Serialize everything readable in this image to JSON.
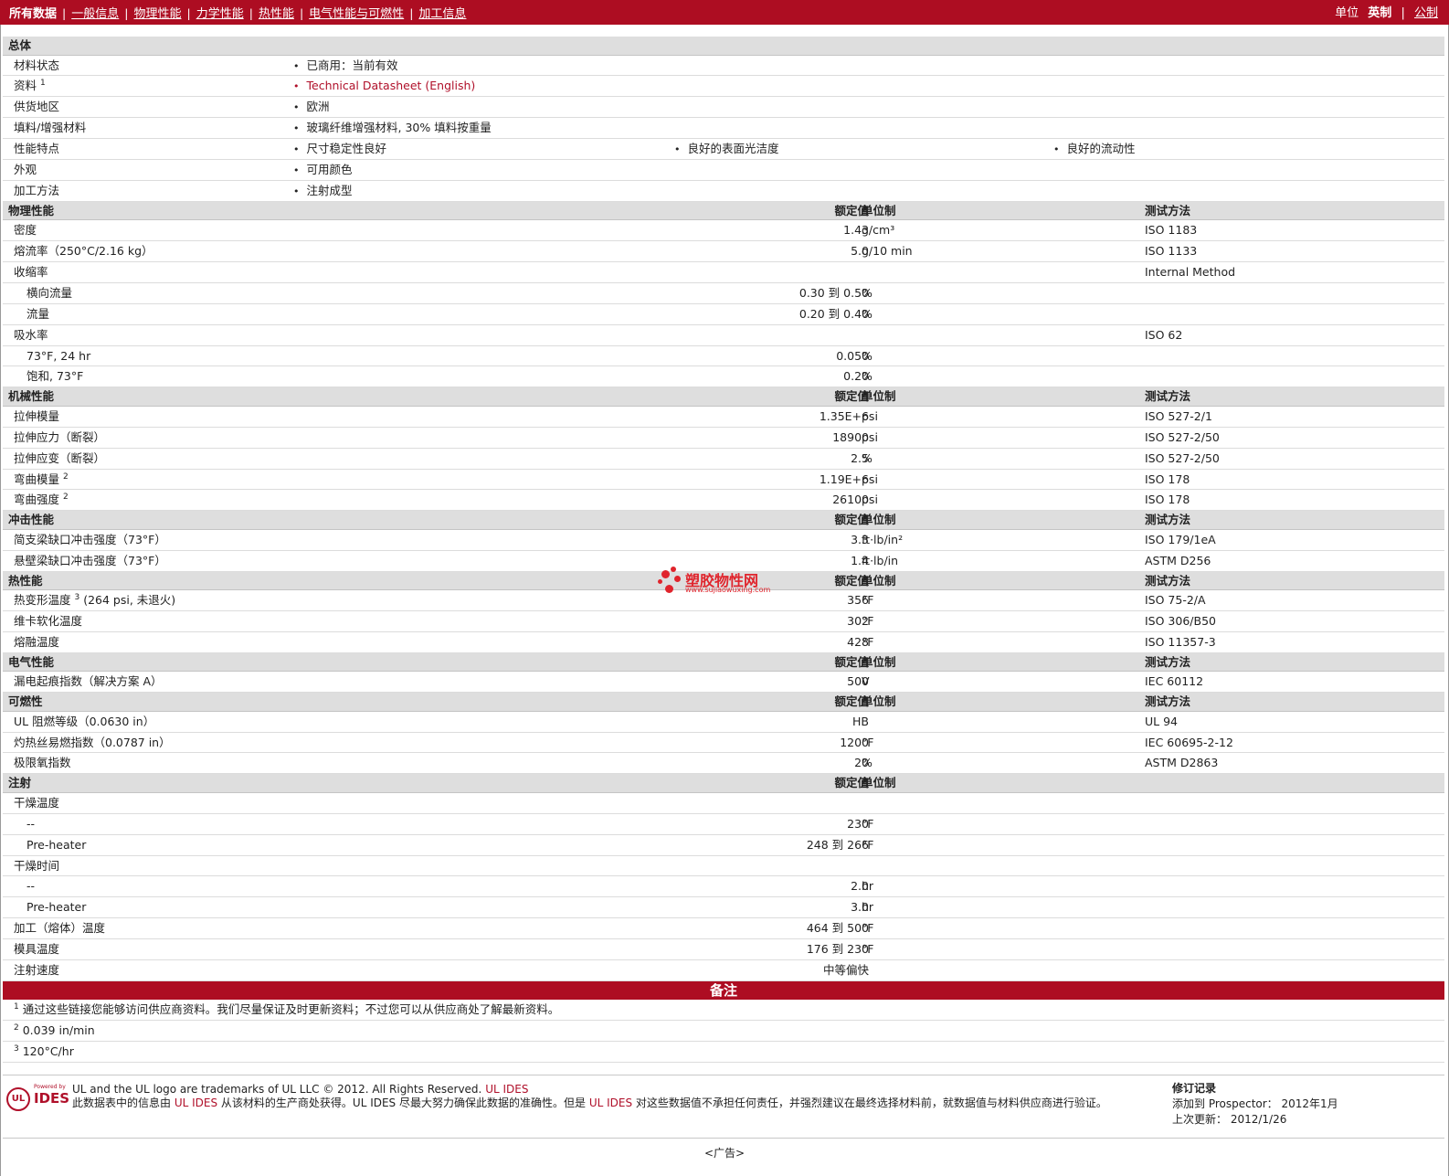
{
  "nav": {
    "tabs": [
      "所有数据",
      "一般信息",
      "物理性能",
      "力学性能",
      "热性能",
      "电气性能与可燃性",
      "加工信息"
    ],
    "units_label": "单位",
    "unit_imperial": "英制",
    "unit_metric": "公制"
  },
  "general": {
    "title": "总体",
    "rows": [
      {
        "label": "材料状态",
        "items": [
          "已商用：当前有效"
        ]
      },
      {
        "label": "资料",
        "sup": "1",
        "items": [
          "Technical Datasheet (English)"
        ],
        "link": true
      },
      {
        "label": "供货地区",
        "items": [
          "欧洲"
        ]
      },
      {
        "label": "填料/增强材料",
        "items": [
          "玻璃纤维增强材料, 30% 填料按重量"
        ]
      },
      {
        "label": "性能特点",
        "items": [
          "尺寸稳定性良好",
          "良好的表面光洁度",
          "良好的流动性"
        ]
      },
      {
        "label": "外观",
        "items": [
          "可用颜色"
        ]
      },
      {
        "label": "加工方法",
        "items": [
          "注射成型"
        ]
      }
    ]
  },
  "col_headers": {
    "value": "额定值",
    "unit": "单位制",
    "method": "测试方法"
  },
  "sections": [
    {
      "title": "物理性能",
      "has_method": true,
      "rows": [
        {
          "label": "密度",
          "value": "1.43",
          "unit": "g/cm³",
          "method": "ISO 1183"
        },
        {
          "label": "熔流率（250°C/2.16 kg）",
          "value": "5.0",
          "unit": "g/10 min",
          "method": "ISO 1133"
        },
        {
          "label": "收缩率",
          "value": "",
          "unit": "",
          "method": "Internal Method"
        },
        {
          "label": "横向流量",
          "sub": true,
          "value": "0.30 到  0.50",
          "unit": "%",
          "method": ""
        },
        {
          "label": "流量",
          "sub": true,
          "value": "0.20 到  0.40",
          "unit": "%",
          "method": ""
        },
        {
          "label": "吸水率",
          "value": "",
          "unit": "",
          "method": "ISO 62"
        },
        {
          "label": "73°F, 24 hr",
          "sub": true,
          "value": "0.050",
          "unit": "%",
          "method": ""
        },
        {
          "label": "饱和, 73°F",
          "sub": true,
          "value": "0.20",
          "unit": "%",
          "method": ""
        }
      ]
    },
    {
      "title": "机械性能",
      "has_method": true,
      "rows": [
        {
          "label": "拉伸模量",
          "value": "1.35E+6",
          "unit": "psi",
          "method": "ISO 527-2/1"
        },
        {
          "label": "拉伸应力（断裂）",
          "value": "18900",
          "unit": "psi",
          "method": "ISO 527-2/50"
        },
        {
          "label": "拉伸应变（断裂）",
          "value": "2.5",
          "unit": "%",
          "method": "ISO 527-2/50"
        },
        {
          "label": "弯曲模量",
          "sup": "2",
          "value": "1.19E+6",
          "unit": "psi",
          "method": "ISO 178"
        },
        {
          "label": "弯曲强度",
          "sup": "2",
          "value": "26100",
          "unit": "psi",
          "method": "ISO 178"
        }
      ]
    },
    {
      "title": "冲击性能",
      "has_method": true,
      "rows": [
        {
          "label": "简支梁缺口冲击强度（73°F）",
          "value": "3.3",
          "unit": "ft·lb/in²",
          "method": "ISO 179/1eA"
        },
        {
          "label": "悬壁梁缺口冲击强度（73°F）",
          "value": "1.4",
          "unit": "ft·lb/in",
          "method": "ASTM D256"
        }
      ]
    },
    {
      "title": "热性能",
      "has_method": true,
      "rows": [
        {
          "label": "热变形温度",
          "sup": "3",
          "label_after": " (264 psi, 未退火)",
          "value": "356",
          "unit": "°F",
          "method": "ISO 75-2/A"
        },
        {
          "label": "维卡软化温度",
          "value": "302",
          "unit": "°F",
          "method": "ISO 306/B50"
        },
        {
          "label": "熔融温度",
          "value": "428",
          "unit": "°F",
          "method": "ISO 11357-3"
        }
      ]
    },
    {
      "title": "电气性能",
      "has_method": true,
      "rows": [
        {
          "label": "漏电起痕指数（解决方案  A）",
          "value": "500",
          "unit": "V",
          "method": "IEC 60112"
        }
      ]
    },
    {
      "title": "可燃性",
      "has_method": true,
      "rows": [
        {
          "label": "UL 阻燃等级（0.0630 in）",
          "value": "HB",
          "unit": "",
          "method": "UL 94"
        },
        {
          "label": "灼热丝易燃指数（0.0787 in）",
          "value": "1200",
          "unit": "°F",
          "method": "IEC 60695-2-12"
        },
        {
          "label": "极限氧指数",
          "value": "20",
          "unit": "%",
          "method": "ASTM D2863"
        }
      ]
    },
    {
      "title": "注射",
      "has_method": false,
      "rows": [
        {
          "label": "干燥温度",
          "value": "",
          "unit": "",
          "method": ""
        },
        {
          "label": "--",
          "sub": true,
          "value": "230",
          "unit": "°F",
          "method": ""
        },
        {
          "label": "Pre-heater",
          "sub": true,
          "value": "248 到  266",
          "unit": "°F",
          "method": ""
        },
        {
          "label": "干燥时间",
          "value": "",
          "unit": "",
          "method": ""
        },
        {
          "label": "--",
          "sub": true,
          "value": "2.0",
          "unit": "hr",
          "method": ""
        },
        {
          "label": "Pre-heater",
          "sub": true,
          "value": "3.0",
          "unit": "hr",
          "method": ""
        },
        {
          "label": "加工（熔体）温度",
          "value": "464 到  500",
          "unit": "°F",
          "method": ""
        },
        {
          "label": "模具温度",
          "value": "176 到  230",
          "unit": "°F",
          "method": ""
        },
        {
          "label": "注射速度",
          "value": "中等偏快",
          "unit": "",
          "method": ""
        }
      ]
    }
  ],
  "notes": {
    "title": "备注",
    "items": [
      {
        "num": "1",
        "text": "通过这些链接您能够访问供应商资料。我们尽量保证及时更新资料；不过您可以从供应商处了解最新资料。"
      },
      {
        "num": "2",
        "text": "0.039 in/min"
      },
      {
        "num": "3",
        "text": "120°C/hr"
      }
    ]
  },
  "watermark": {
    "name": "塑胶物性网",
    "url": "www.sujiaowuxing.com"
  },
  "footer": {
    "logo_powered": "Powered by",
    "logo_ul": "UL",
    "logo_ides": "IDES",
    "line1": "UL and the UL logo are trademarks of UL LLC © 2012. All Rights Reserved.",
    "line1_link": "UL IDES",
    "line2_a": "此数据表中的信息由 ",
    "line2_link1": "UL IDES",
    "line2_b": " 从该材料的生产商处获得。UL IDES 尽最大努力确保此数据的准确性。但是 ",
    "line2_link2": "UL IDES",
    "line2_c": " 对这些数据值不承担任何责任，并强烈建议在最终选择材料前，就数据值与材料供应商进行验证。",
    "rev_title": "修订记录",
    "rev_added": "添加到  Prospector：   2012年1月",
    "rev_updated": "上次更新：   2012/1/26"
  },
  "ad": "<广告>"
}
